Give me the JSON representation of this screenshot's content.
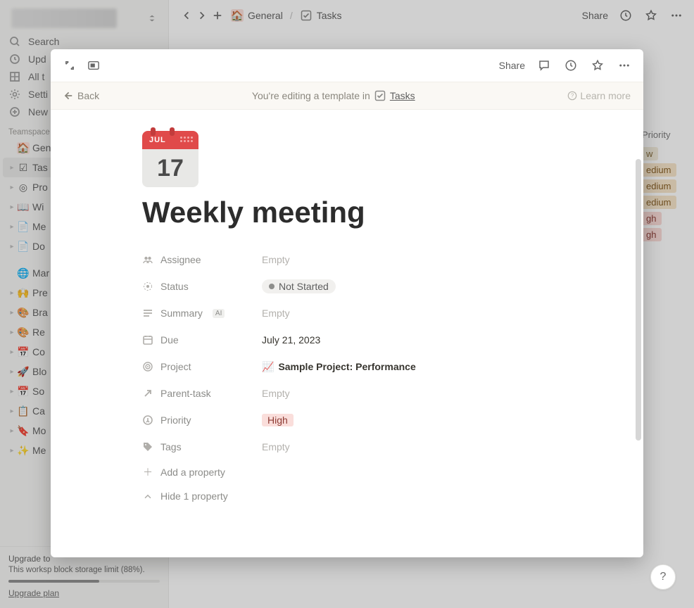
{
  "sidebar": {
    "quick": [
      {
        "icon": "search",
        "label": "Search"
      },
      {
        "icon": "clock",
        "label": "Upd"
      },
      {
        "icon": "grid",
        "label": "All t"
      },
      {
        "icon": "gear",
        "label": "Setti"
      },
      {
        "icon": "plus-circle",
        "label": "New"
      }
    ],
    "section_label": "Teamspace",
    "teamspace": [
      {
        "icon": "🏠",
        "label": "Gene",
        "bg": "#fadfda",
        "selected": false,
        "caret": false
      },
      {
        "icon": "☑",
        "label": "Tas",
        "selected": true,
        "caret": true
      },
      {
        "icon": "◎",
        "label": "Pro",
        "caret": true
      },
      {
        "icon": "📖",
        "label": "Wi",
        "caret": true
      },
      {
        "icon": "📄",
        "label": "Me",
        "caret": true
      },
      {
        "icon": "📄",
        "label": "Do",
        "caret": true
      }
    ],
    "other": [
      {
        "icon": "🌐",
        "label": "Mar",
        "caret": false
      },
      {
        "icon": "🙌",
        "label": "Pre",
        "caret": true
      },
      {
        "icon": "🎨",
        "label": "Bra",
        "caret": true
      },
      {
        "icon": "🎨",
        "label": "Re",
        "caret": true
      },
      {
        "icon": "📅",
        "label": "Co",
        "caret": true
      },
      {
        "icon": "🚀",
        "label": "Blo",
        "caret": true
      },
      {
        "icon": "📅",
        "label": "So",
        "caret": true
      },
      {
        "icon": "📋",
        "label": "Ca",
        "caret": true
      },
      {
        "icon": "🔖",
        "label": "Mo",
        "caret": true
      },
      {
        "icon": "✨",
        "label": "Me",
        "caret": true
      }
    ],
    "upgrade": {
      "title": "Upgrade to",
      "body": "This worksp block storage limit (88%).",
      "link": "Upgrade plan"
    }
  },
  "topbar": {
    "crumb1": "General",
    "crumb2": "Tasks",
    "share": "Share"
  },
  "bg_table": {
    "header": "Priority",
    "rows": [
      "w",
      "edium",
      "edium",
      "edium",
      "gh",
      "gh"
    ]
  },
  "modal": {
    "toolbar": {
      "share": "Share"
    },
    "banner": {
      "back": "Back",
      "text": "You're editing a template in",
      "db": "Tasks",
      "learn": "Learn more"
    },
    "page": {
      "icon": {
        "month": "JUL",
        "day": "17"
      },
      "title": "Weekly meeting",
      "properties": [
        {
          "key": "Assignee",
          "icon": "people",
          "value": "Empty",
          "empty": true
        },
        {
          "key": "Status",
          "icon": "status",
          "value": "Not Started",
          "kind": "status"
        },
        {
          "key": "Summary",
          "icon": "lines",
          "badge": "AI",
          "value": "Empty",
          "empty": true
        },
        {
          "key": "Due",
          "icon": "calendar",
          "value": "July 21, 2023"
        },
        {
          "key": "Project",
          "icon": "target",
          "value": "Sample Project: Performance",
          "kind": "project",
          "picon": "📈"
        },
        {
          "key": "Parent-task",
          "icon": "arrow-up-right",
          "value": "Empty",
          "empty": true
        },
        {
          "key": "Priority",
          "icon": "shield-down",
          "value": "High",
          "kind": "priority"
        },
        {
          "key": "Tags",
          "icon": "tag",
          "value": "Empty",
          "empty": true
        }
      ],
      "add_property": "Add a property",
      "hide_property": "Hide 1 property"
    }
  },
  "help": "?"
}
